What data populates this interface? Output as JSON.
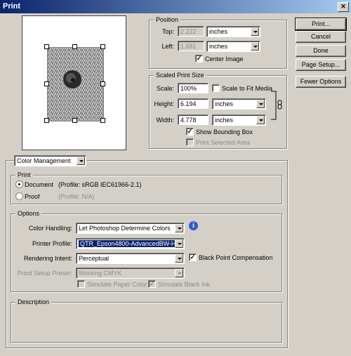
{
  "window": {
    "title": "Print"
  },
  "buttons": {
    "print": "Print...",
    "cancel": "Cancel",
    "done": "Done",
    "page_setup": "Page Setup...",
    "fewer_options": "Fewer Options"
  },
  "position": {
    "group_label": "Position",
    "top_label": "Top:",
    "top_value": "2.222",
    "top_unit": "inches",
    "left_label": "Left:",
    "left_value": "1.681",
    "left_unit": "inches",
    "center_image_label": "Center Image",
    "center_image_checked": true
  },
  "scaled": {
    "group_label": "Scaled Print Size",
    "scale_label": "Scale:",
    "scale_value": "100%",
    "scale_to_fit_label": "Scale to Fit Media",
    "scale_to_fit_checked": false,
    "height_label": "Height:",
    "height_value": "6.194",
    "height_unit": "inches",
    "width_label": "Width:",
    "width_value": "4.778",
    "width_unit": "inches",
    "show_bounding_box_label": "Show Bounding Box",
    "show_bounding_box_checked": true,
    "print_selected_area_label": "Print Selected Area",
    "print_selected_area_checked": false
  },
  "mode_select": "Color Management",
  "print_group": {
    "label": "Print",
    "document_label": "Document",
    "document_profile": "(Profile: sRGB IEC61966-2.1)",
    "proof_label": "Proof",
    "proof_profile": "(Profile: N/A)",
    "selected": "Document"
  },
  "options": {
    "label": "Options",
    "color_handling_label": "Color Handling:",
    "color_handling_value": "Let Photoshop Determine Colors",
    "printer_profile_label": "Printer Profile:",
    "printer_profile_value": "QTR_Epson4800-AdvancedBW-H...",
    "rendering_intent_label": "Rendering Intent:",
    "rendering_intent_value": "Perceptual",
    "black_point_label": "Black Point Compensation",
    "black_point_checked": true,
    "proof_setup_label": "Proof Setup Preset:",
    "proof_setup_value": "Working CMYK",
    "simulate_paper_label": "Simulate Paper Color",
    "simulate_ink_label": "Simulate Black Ink"
  },
  "description": {
    "label": "Description"
  }
}
